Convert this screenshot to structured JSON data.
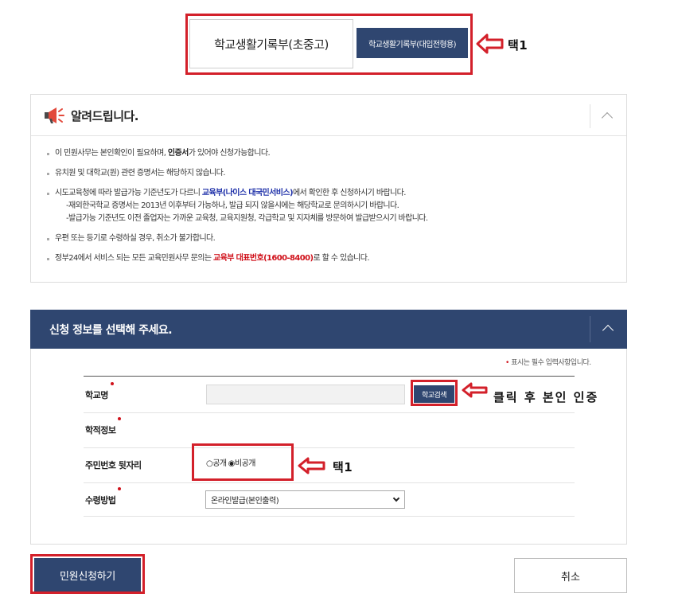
{
  "tabs": {
    "active": "학교생활기록부(초중고)",
    "inactive": "학교생활기록부(대입전형용)"
  },
  "annotations": {
    "tab_note": "택1",
    "search_note": "클릭 후 본인 인증",
    "radio_note": "택1"
  },
  "notice": {
    "title": "알려드립니다.",
    "items": [
      {
        "pre": "이 민원사무는 본인확인이 필요하며, ",
        "bold": "인증서",
        "post": "가 있어야 신청가능합니다."
      },
      {
        "text": "유치원 및 대학교(원) 관련 증명서는 해당하지 않습니다."
      },
      {
        "pre": "시도교육청에 따라 발급가능 기준년도가 다르니 ",
        "blue": "교육부(나이스 대국민서비스)",
        "post": "에서 확인한 후 신청하시기 바랍니다.",
        "sub1": "-재외한국학교 증명서는 2013년 이후부터 가능하나, 발급 되지 않을시에는 해당학교로 문의하시기 바랍니다.",
        "sub2": "-발급가능 기준년도 이전 졸업자는 가까운 교육청, 교육지원청, 각급학교 및 지자체를 방문하여 발급받으시기 바랍니다."
      },
      {
        "text": "우편 또는 등기로 수령하실 경우, 취소가 불가합니다."
      },
      {
        "pre": "정부24에서 서비스 되는 모든 교육민원사무 문의는 ",
        "red": "교육부 대표번호(1600-8400)",
        "post": "로 할 수 있습니다."
      }
    ]
  },
  "apply": {
    "title": "신청 정보를 선택해 주세요.",
    "required_note": "표시는 필수 입력사항입니다.",
    "school_label": "학교명",
    "school_value": "",
    "search_button": "학교검색",
    "record_label": "학적정보",
    "rrn_label": "주민번호 뒷자리",
    "radio_public": "공개",
    "radio_private": "비공개",
    "receive_label": "수령방법",
    "receive_value": "온라인발급(본인출력)"
  },
  "buttons": {
    "submit": "민원신청하기",
    "cancel": "취소"
  },
  "colors": {
    "navy": "#2f4670",
    "annotation_red": "#d3202a",
    "link_blue": "#1d2fa8",
    "highlight_red": "#d0121b"
  }
}
